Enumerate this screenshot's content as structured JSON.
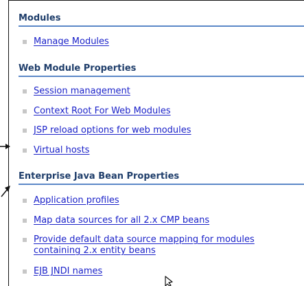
{
  "sections": [
    {
      "heading": "Modules",
      "items": [
        "Manage Modules"
      ]
    },
    {
      "heading": "Web Module Properties",
      "items": [
        "Session management",
        "Context Root For Web Modules",
        "JSP reload options for web modules",
        "Virtual hosts"
      ]
    },
    {
      "heading": "Enterprise Java Bean Properties",
      "items": [
        "Application profiles",
        "Map data sources for all 2.x CMP beans",
        "Provide default data source mapping for modules containing 2.x entity beans",
        "EJB JNDI names"
      ]
    }
  ]
}
